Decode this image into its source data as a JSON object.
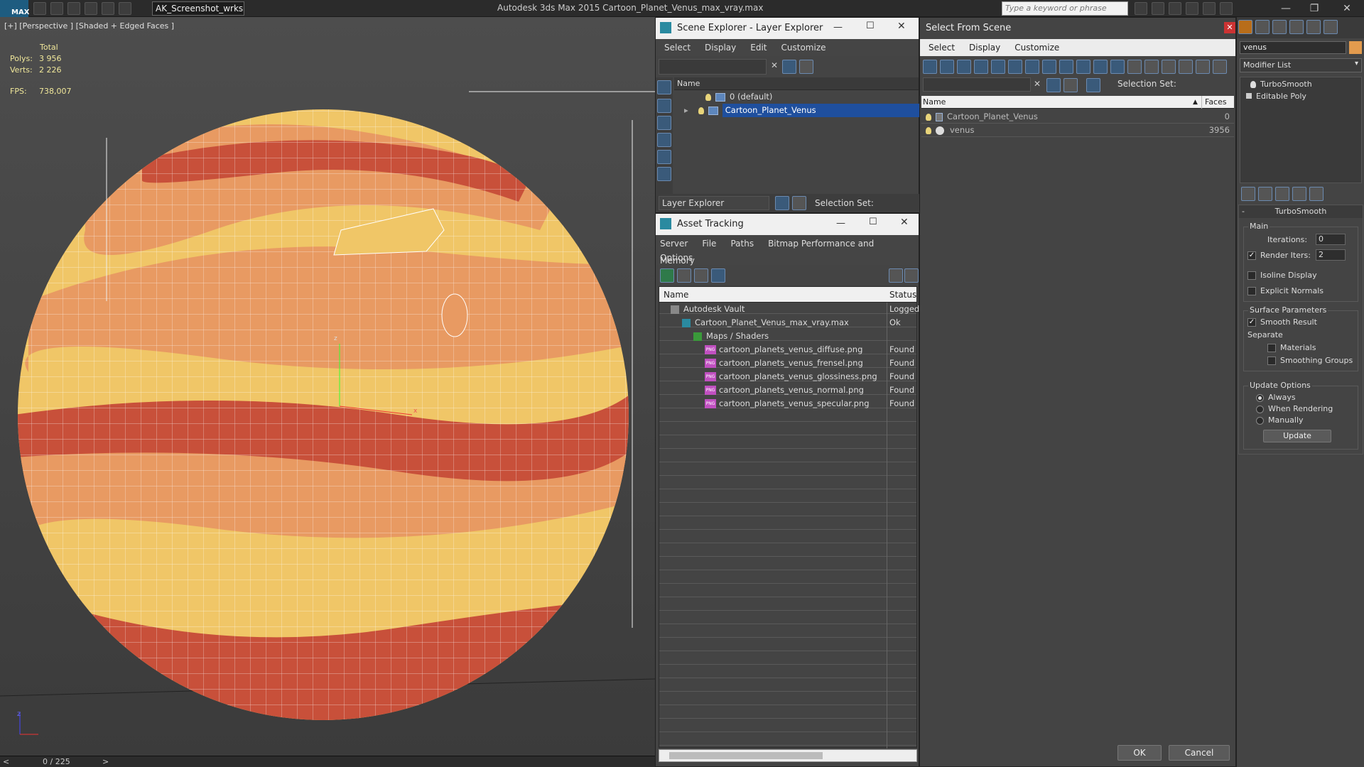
{
  "titlebar": {
    "logo": "MAX",
    "workspace": "AK_Screenshot_wrksp",
    "app_title": "Autodesk 3ds Max  2015     Cartoon_Planet_Venus_max_vray.max",
    "search_placeholder": "Type a keyword or phrase"
  },
  "viewport": {
    "label": "[+] [Perspective ] [Shaded + Edged Faces ]",
    "stats_header": "Total",
    "polys_label": "Polys:",
    "polys_value": "3 956",
    "verts_label": "Verts:",
    "verts_value": "2 226",
    "fps_label": "FPS:",
    "fps_value": "738,007",
    "axis_z": "z",
    "axis_x": "x"
  },
  "timeline": {
    "frame": "0 / 225",
    "prev": "<",
    "next": ">"
  },
  "scene_explorer": {
    "title": "Scene Explorer - Layer Explorer",
    "menu": [
      "Select",
      "Display",
      "Edit",
      "Customize"
    ],
    "col_name": "Name",
    "layers": [
      {
        "name": "0 (default)",
        "selected": false
      },
      {
        "name": "Cartoon_Planet_Venus",
        "selected": true
      }
    ],
    "footer_combo": "Layer Explorer",
    "selection_set": "Selection Set:"
  },
  "asset_tracking": {
    "title": "Asset Tracking",
    "menu": [
      "Server",
      "File",
      "Paths",
      "Bitmap Performance and Memory"
    ],
    "menu2": "Options",
    "col_name": "Name",
    "col_status": "Status",
    "rows": [
      {
        "name": "Autodesk Vault",
        "status": "Logged",
        "indent": 1,
        "kind": "vault"
      },
      {
        "name": "Cartoon_Planet_Venus_max_vray.max",
        "status": "Ok",
        "indent": 2,
        "kind": "max"
      },
      {
        "name": "Maps / Shaders",
        "status": "",
        "indent": 3,
        "kind": "maps"
      },
      {
        "name": "cartoon_planets_venus_diffuse.png",
        "status": "Found",
        "indent": 4,
        "kind": "png"
      },
      {
        "name": "cartoon_planets_venus_frensel.png",
        "status": "Found",
        "indent": 4,
        "kind": "png"
      },
      {
        "name": "cartoon_planets_venus_glossiness.png",
        "status": "Found",
        "indent": 4,
        "kind": "png"
      },
      {
        "name": "cartoon_planets_venus_normal.png",
        "status": "Found",
        "indent": 4,
        "kind": "png"
      },
      {
        "name": "cartoon_planets_venus_specular.png",
        "status": "Found",
        "indent": 4,
        "kind": "png"
      }
    ],
    "png_badge": "PNG"
  },
  "select_from_scene": {
    "title": "Select From Scene",
    "menu": [
      "Select",
      "Display",
      "Customize"
    ],
    "selection_set": "Selection Set:",
    "col_name": "Name",
    "col_faces": "Faces",
    "rows": [
      {
        "name": "Cartoon_Planet_Venus",
        "faces": "0"
      },
      {
        "name": "venus",
        "faces": "3956"
      }
    ],
    "ok": "OK",
    "cancel": "Cancel"
  },
  "modifier_panel": {
    "object_name": "venus",
    "modifier_list": "Modifier List",
    "stack": [
      "TurboSmooth",
      "Editable Poly"
    ],
    "rollout_title": "TurboSmooth",
    "main_label": "Main",
    "iterations_label": "Iterations:",
    "iterations_value": "0",
    "render_iters_label": "Render Iters:",
    "render_iters_value": "2",
    "isoline_label": "Isoline Display",
    "explicit_normals_label": "Explicit Normals",
    "surface_params_label": "Surface Parameters",
    "smooth_result_label": "Smooth Result",
    "separate_label": "Separate",
    "materials_label": "Materials",
    "smoothing_groups_label": "Smoothing Groups",
    "update_options_label": "Update Options",
    "always_label": "Always",
    "when_rendering_label": "When Rendering",
    "manually_label": "Manually",
    "update_button": "Update"
  },
  "colors": {
    "planet_yellow": "#f0c667",
    "planet_orange": "#e89a62",
    "planet_red": "#c8503a",
    "selection_blue": "#1f4f9e"
  }
}
